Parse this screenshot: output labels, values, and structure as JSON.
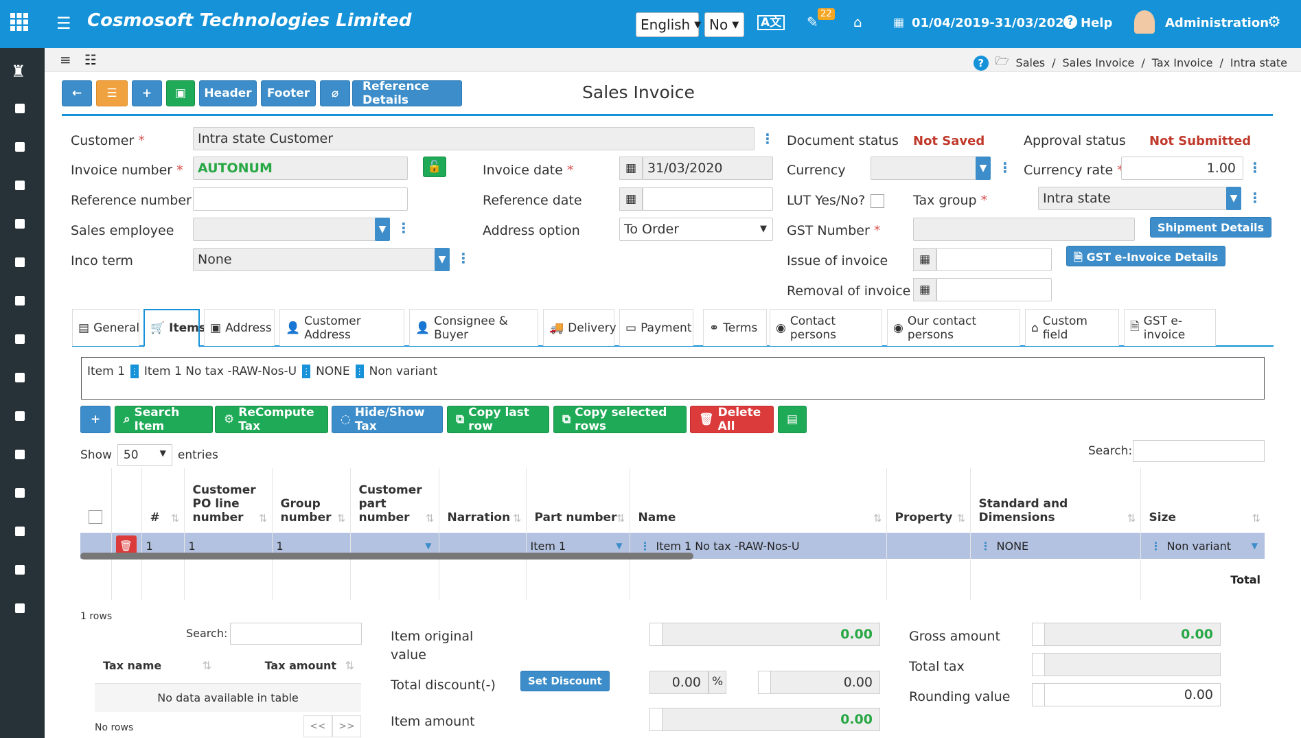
{
  "topbar": {
    "brand": "Cosmosoft Technologies Limited",
    "language": "English",
    "no_select": "No",
    "notification_count": "22",
    "period": "01/04/2019-31/03/2020",
    "help": "Help",
    "user": "Administration"
  },
  "breadcrumb": [
    "Sales",
    "/",
    "Sales Invoice",
    "/",
    "Tax Invoice",
    "/",
    "Intra state"
  ],
  "toolbar": {
    "header": "Header",
    "footer": "Footer",
    "reference_details": "Reference Details"
  },
  "page_title": "Sales Invoice",
  "form": {
    "customer_label": "Customer",
    "customer_value": "Intra state Customer",
    "invoice_number_label": "Invoice number",
    "invoice_number_value": "AUTONUM",
    "reference_number_label": "Reference number",
    "sales_employee_label": "Sales employee",
    "inco_term_label": "Inco term",
    "inco_term_value": "None",
    "invoice_date_label": "Invoice date",
    "invoice_date_value": "31/03/2020",
    "reference_date_label": "Reference date",
    "address_option_label": "Address option",
    "address_option_value": "To Order",
    "document_status_label": "Document status",
    "document_status_value": "Not Saved",
    "approval_status_label": "Approval status",
    "approval_status_value": "Not Submitted",
    "currency_label": "Currency",
    "currency_rate_label": "Currency rate",
    "currency_rate_value": "1.00",
    "lut_label": "LUT Yes/No?",
    "tax_group_label": "Tax group",
    "tax_group_value": "Intra state",
    "gst_number_label": "GST Number",
    "shipment_details": "Shipment Details",
    "issue_label": "Issue of invoice",
    "gst_einvoice_details": "GST e-Invoice Details",
    "removal_label": "Removal of invoice"
  },
  "tabs": [
    "General",
    "Items",
    "Address",
    "Customer Address",
    "Consignee & Buyer",
    "Delivery",
    "Payment",
    "Terms",
    "Contact persons",
    "Our contact persons",
    "Custom field",
    "GST e-invoice"
  ],
  "item_box": {
    "code": "Item 1",
    "name": "Item 1 No tax -RAW-Nos-U",
    "std": "NONE",
    "variant": "Non variant"
  },
  "actions": {
    "search_item": "Search Item",
    "recompute_tax": "ReCompute Tax",
    "hide_show_tax": "Hide/Show Tax",
    "copy_last_row": "Copy last row",
    "copy_selected_rows": "Copy selected rows",
    "delete_all": "Delete All"
  },
  "table": {
    "show": "Show",
    "entries_value": "50",
    "entries": "entries",
    "search": "Search:",
    "headers": [
      "#",
      "Customer PO line number",
      "Group number",
      "Customer part number",
      "Narration",
      "Part number",
      "Name",
      "Property",
      "Standard and Dimensions",
      "Size"
    ],
    "row": {
      "num": "1",
      "po_line": "1",
      "group": "1",
      "part_number": "Item 1",
      "name": "Item 1 No tax -RAW-Nos-U",
      "std": "NONE",
      "size": "Non variant"
    },
    "footer_total": "Total",
    "rows_info": "1 rows"
  },
  "tax_table": {
    "search": "Search:",
    "headers": [
      "Tax name",
      "Tax amount"
    ],
    "empty": "No data available in table",
    "no_rows": "No rows",
    "prev": "<<",
    "next": ">>"
  },
  "totals": {
    "item_original_value_label": "Item original value",
    "item_original_value": "0.00",
    "total_discount_label": "Total discount(-)",
    "set_discount": "Set Discount",
    "discount_percent": "0.00",
    "percent_sign": "%",
    "discount_amount": "0.00",
    "item_amount_label": "Item amount",
    "item_amount": "0.00",
    "gross_amount_label": "Gross amount",
    "gross_amount": "0.00",
    "total_tax_label": "Total tax",
    "rounding_label": "Rounding value",
    "rounding_value": "0.00"
  }
}
